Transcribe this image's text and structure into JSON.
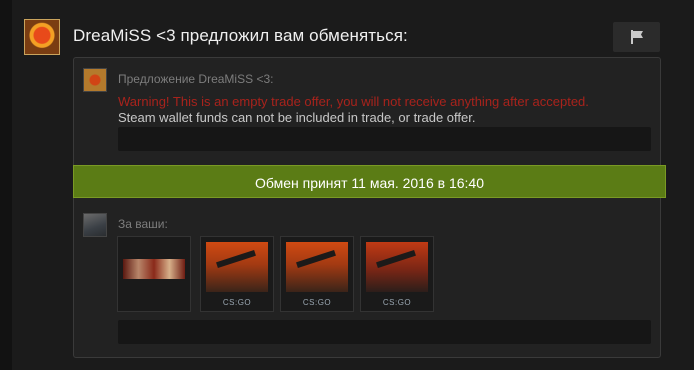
{
  "header": {
    "title": "DreaMiSS <3 предложил вам обменяться:",
    "report_icon": "flag-icon"
  },
  "offer": {
    "label": "Предложение DreaMiSS <3:",
    "warning": "Warning! This is an empty trade offer, you will not receive anything after accepted.",
    "wallet_note": "Steam wallet funds can not be included in trade, or trade offer."
  },
  "status": {
    "banner": "Обмен принят 11 мая. 2016 в 16:40",
    "color": "#5b7c15"
  },
  "yours": {
    "label": "За ваши:",
    "items": [
      {
        "name": "graffiti-sticker-item"
      },
      {
        "name": "csgo-case-soldier-item",
        "logo": "CS:GO"
      },
      {
        "name": "csgo-case-soldier-item",
        "logo": "CS:GO"
      },
      {
        "name": "csgo-case-sniper-item",
        "logo": "CS:GO"
      }
    ]
  },
  "colors": {
    "background": "#1b1b1b",
    "warning": "#a8231c",
    "muted_text": "#7d7d7d"
  }
}
